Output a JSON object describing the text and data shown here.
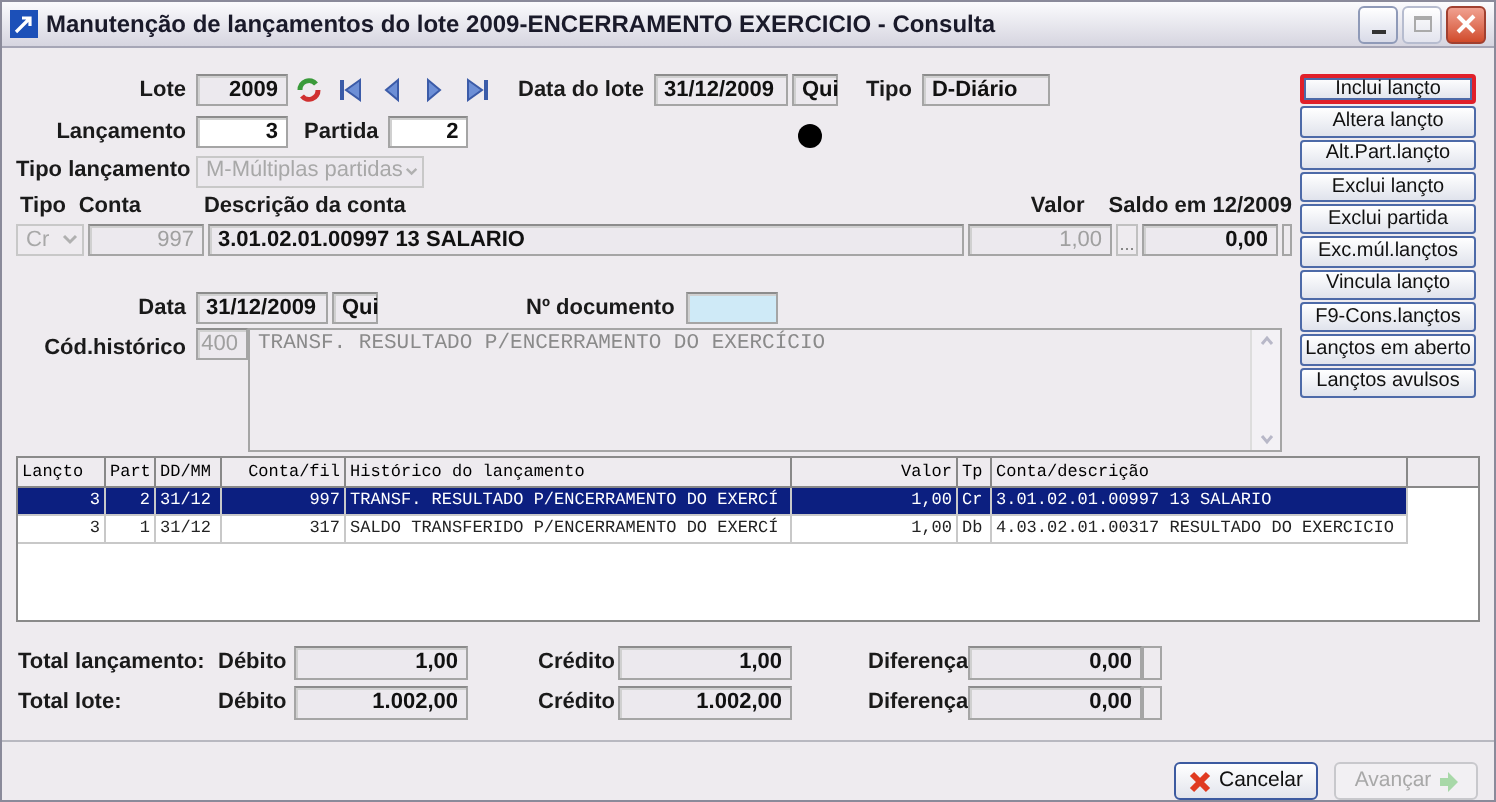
{
  "window": {
    "title": "Manutenção de lançamentos do lote 2009-ENCERRAMENTO EXERCICIO - Consulta"
  },
  "form": {
    "lote": {
      "label": "Lote",
      "value": "2009"
    },
    "data_lote": {
      "label": "Data do lote",
      "value": "31/12/2009",
      "weekday": "Qui"
    },
    "tipo": {
      "label": "Tipo",
      "value": "D-Diário"
    },
    "lancamento": {
      "label": "Lançamento",
      "value": "3"
    },
    "partida": {
      "label": "Partida",
      "value": "2"
    },
    "tipo_lancamento": {
      "label": "Tipo lançamento",
      "value": "M-Múltiplas partidas",
      "disabled": true
    },
    "entry_headers": [
      "Tipo",
      "Conta",
      "Descrição da conta",
      "Valor",
      "Saldo em 12/2009"
    ],
    "entry": {
      "tipo": "Cr",
      "conta": "997",
      "descricao": "3.01.02.01.00997 13 SALARIO",
      "valor": "1,00",
      "valor_button": "...",
      "saldo": "0,00"
    },
    "data": {
      "label": "Data",
      "value": "31/12/2009",
      "weekday": "Qui"
    },
    "documento": {
      "label": "Nº documento"
    },
    "historico": {
      "label": "Cód.histórico",
      "code": "400",
      "text": "TRANSF. RESULTADO P/ENCERRAMENTO DO EXERCÍCIO"
    }
  },
  "actions": [
    {
      "label": "Inclui lançto",
      "highlighted": true
    },
    {
      "label": "Altera lançto",
      "highlighted": false
    },
    {
      "label": "Alt.Part.lançto",
      "highlighted": false
    },
    {
      "label": "Exclui lançto",
      "highlighted": false
    },
    {
      "label": "Exclui partida",
      "highlighted": false
    },
    {
      "label": "Exc.múl.lançtos",
      "highlighted": false
    },
    {
      "label": "Vincula lançto",
      "highlighted": false
    },
    {
      "label": "F9-Cons.lançtos",
      "highlighted": false
    },
    {
      "label": "Lançtos em aberto",
      "highlighted": false
    },
    {
      "label": "Lançtos avulsos",
      "highlighted": false
    }
  ],
  "grid": {
    "columns": [
      "Lançto",
      "Part",
      "DD/MM",
      "Conta/fil",
      "Histórico do lançamento",
      "Valor",
      "Tp",
      "Conta/descrição"
    ],
    "rows": [
      {
        "cells": [
          "3",
          "2",
          "31/12",
          "997",
          "TRANSF. RESULTADO P/ENCERRAMENTO DO EXERCÍ",
          "1,00",
          "Cr",
          "3.01.02.01.00997 13 SALARIO"
        ],
        "selected": true
      },
      {
        "cells": [
          "3",
          "1",
          "31/12",
          "317",
          "SALDO TRANSFERIDO P/ENCERRAMENTO DO EXERCÍ",
          "1,00",
          "Db",
          "4.03.02.01.00317 RESULTADO DO EXERCICIO"
        ],
        "selected": false
      }
    ]
  },
  "totals": [
    {
      "label": "Total lançamento:",
      "debito_label": "Débito",
      "debito": "1,00",
      "credito_label": "Crédito",
      "credito": "1,00",
      "diferenca_label": "Diferença",
      "diferenca": "0,00"
    },
    {
      "label": "Total lote:",
      "debito_label": "Débito",
      "debito": "1.002,00",
      "credito_label": "Crédito",
      "credito": "1.002,00",
      "diferenca_label": "Diferença",
      "diferenca": "0,00"
    }
  ],
  "buttons": [
    {
      "kind": "cancel",
      "label": "Cancelar",
      "disabled": false
    },
    {
      "kind": "next",
      "label": "Avançar",
      "disabled": true
    }
  ]
}
